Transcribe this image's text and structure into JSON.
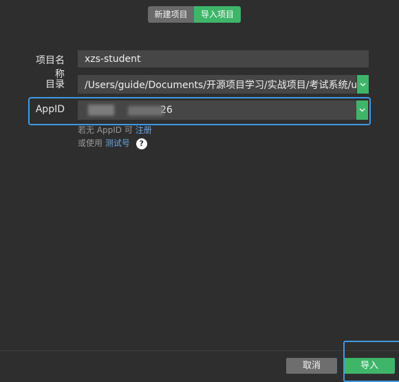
{
  "tabs": [
    {
      "label": "新建项目",
      "active": false
    },
    {
      "label": "导入项目",
      "active": true
    }
  ],
  "form": {
    "project_name_label": "项目名称",
    "project_name_value": "xzs-student",
    "directory_label": "目录",
    "directory_value": "/Users/guide/Documents/开源项目学习/实战项目/考试系统/uexam/source",
    "appid_label": "AppID",
    "appid_value_visible": "26"
  },
  "hints": {
    "no_appid_text": "若无 AppID 可",
    "register_link": "注册",
    "or_use_text": "或使用",
    "test_id_link": "测试号",
    "help_glyph": "?"
  },
  "footer": {
    "cancel_label": "取消",
    "import_label": "导入"
  },
  "colors": {
    "accent_green": "#3fb56a",
    "highlight_blue": "#3c9be8",
    "background": "#2e2e2e"
  },
  "icons": {
    "dropdown": "chevron-down-icon",
    "help": "question-circle-icon"
  }
}
